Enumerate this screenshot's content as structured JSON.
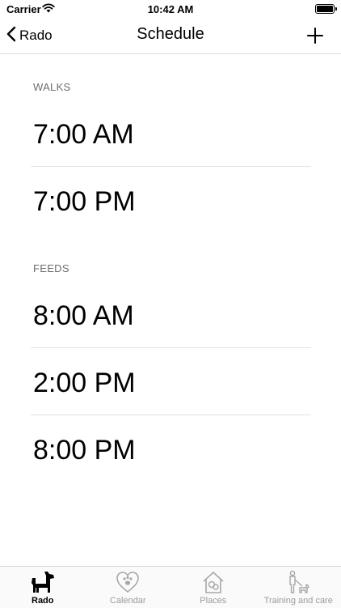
{
  "status_bar": {
    "carrier": "Carrier",
    "time": "10:42 AM"
  },
  "nav": {
    "back_label": "Rado",
    "title": "Schedule",
    "add_icon": "plus-icon"
  },
  "sections": [
    {
      "header": "WALKS",
      "items": [
        "7:00 AM",
        "7:00 PM"
      ]
    },
    {
      "header": "FEEDS",
      "items": [
        "8:00 AM",
        "2:00 PM",
        "8:00 PM"
      ]
    }
  ],
  "tab_bar": {
    "tabs": [
      {
        "label": "Rado",
        "icon": "dog-icon",
        "active": true
      },
      {
        "label": "Calendar",
        "icon": "heart-paw-icon",
        "active": false
      },
      {
        "label": "Places",
        "icon": "house-pet-icon",
        "active": false
      },
      {
        "label": "Training and care",
        "icon": "person-dog-icon",
        "active": false
      }
    ]
  },
  "colors": {
    "section_header": "#6d6d72",
    "divider": "#e3e3e6",
    "tab_inactive": "#9b9b9b"
  }
}
